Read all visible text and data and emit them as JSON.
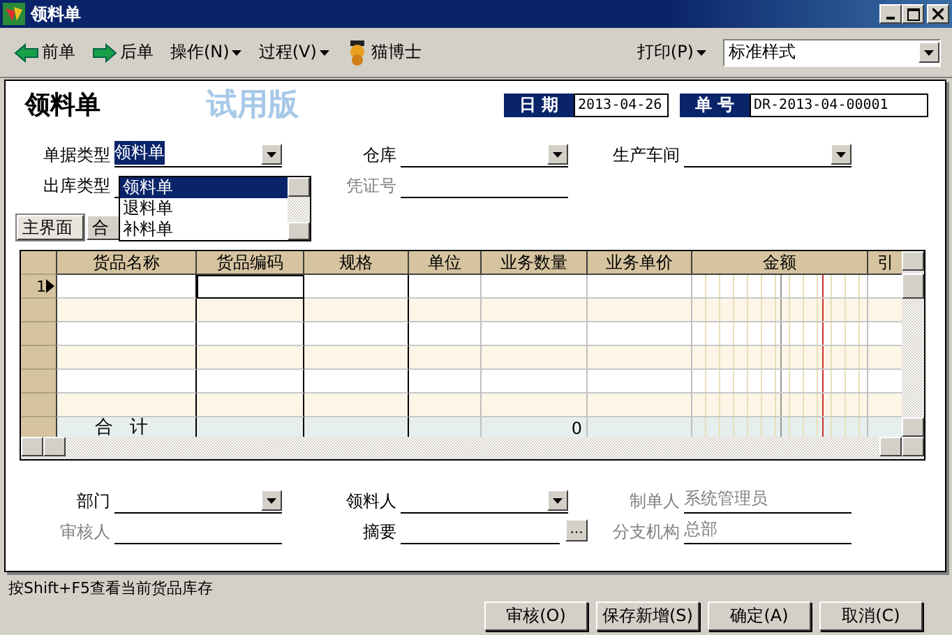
{
  "window": {
    "title": "领料单"
  },
  "toolbar": {
    "items": [
      {
        "kind": "back",
        "label": "前单"
      },
      {
        "kind": "forward",
        "label": "后单"
      },
      {
        "kind": "menu",
        "label": "操作(N)"
      },
      {
        "kind": "menu",
        "label": "过程(V)"
      },
      {
        "kind": "mascot",
        "label": "猫博士"
      }
    ],
    "print": "打印(P)",
    "style_select": "标准样式"
  },
  "header": {
    "title": "领料单",
    "trial": "试用版",
    "date_label": "日 期",
    "date": "2013-04-26",
    "number_label": "单 号",
    "number": "DR-2013-04-00001"
  },
  "form_rows": [
    [
      {
        "label": "单据类型",
        "kind": "dropdown",
        "value": "领料单",
        "highlighted": true,
        "disabled": false
      },
      {
        "label": "仓库",
        "kind": "dropdown",
        "disabled": false
      },
      {
        "label": "生产车间",
        "kind": "dropdown",
        "disabled": false
      }
    ],
    [
      {
        "label": "出库类型",
        "kind": "text",
        "disabled": false
      },
      {
        "label": "凭证号",
        "kind": "text",
        "disabled": true
      }
    ]
  ],
  "dropdown_list": {
    "items": [
      {
        "label": "领料单",
        "selected": true
      },
      {
        "label": "退料单",
        "selected": false
      },
      {
        "label": "补料单",
        "selected": false
      }
    ]
  },
  "tabs": [
    {
      "label": "主界面",
      "selected": true
    },
    {
      "label": "合",
      "selected": false
    }
  ],
  "grid": {
    "columns": [
      "货品名称",
      "货品编码",
      "规格",
      "单位",
      "业务数量",
      "业务单价",
      "金额",
      "引"
    ],
    "rows": [
      {
        "number": "1",
        "current": true
      },
      {
        "current": false
      },
      {
        "current": false
      },
      {
        "current": false
      },
      {
        "current": false
      },
      {
        "current": false
      }
    ],
    "total": {
      "label": "合 计",
      "quantity": "0"
    }
  },
  "bottom_rows": [
    [
      {
        "label": "部门",
        "kind": "dropdown",
        "disabled": false
      },
      {
        "label": "领料人",
        "kind": "dropdown",
        "disabled": false
      },
      {
        "label": "制单人",
        "kind": "text",
        "value": "系统管理员",
        "disabled": true
      }
    ],
    [
      {
        "label": "审核人",
        "kind": "text",
        "disabled": true
      },
      {
        "label": "摘要",
        "kind": "ellipsis",
        "button_label": "...",
        "disabled": false
      },
      {
        "label": "分支机构",
        "kind": "text",
        "value": "总部",
        "disabled": true
      }
    ]
  ],
  "status_hint": "按Shift+F5查看当前货品库存",
  "buttons": [
    "审核(O)",
    "保存新增(S)",
    "确定(A)",
    "取消(C)"
  ]
}
